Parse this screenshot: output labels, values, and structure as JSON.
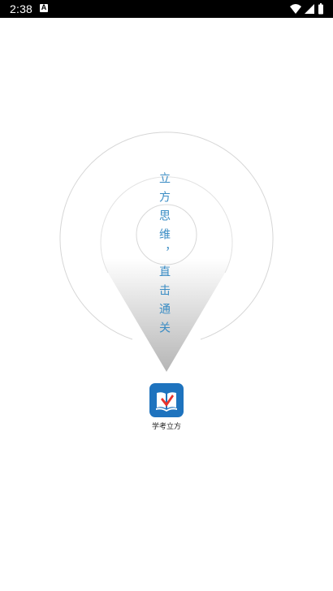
{
  "status_bar": {
    "time": "2:38",
    "notification_icon": "a-icon",
    "icons": [
      "wifi-icon",
      "signal-icon",
      "battery-icon"
    ]
  },
  "splash": {
    "slogan": "立方思维，直击通关",
    "colors": {
      "slogan": "#3a8cc4",
      "icon_bg": "#1e73be"
    }
  },
  "app": {
    "name": "学考立方",
    "icon": "book-logo-icon"
  }
}
